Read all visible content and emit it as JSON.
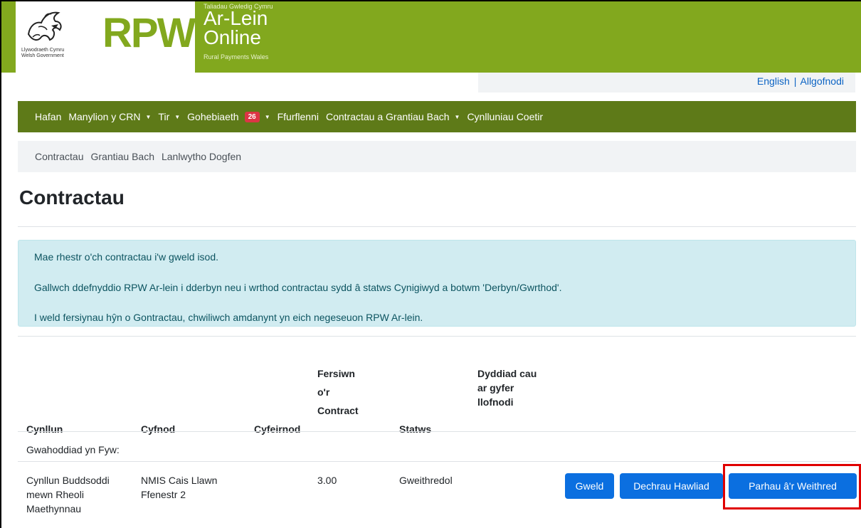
{
  "header": {
    "gov_name_line1": "Llywodraeth Cymru",
    "gov_name_line2": "Welsh Government",
    "rpw_logo": "RPW",
    "tagline_top": "Taliadau Gwledig Cymru",
    "product_line1": "Ar-Lein",
    "product_line2": "Online",
    "tagline_bottom": "Rural Payments Wales"
  },
  "utility": {
    "english_link": "English",
    "separator": "|",
    "logout_link": "Allgofnodi"
  },
  "main_nav": {
    "items": [
      {
        "label": "Hafan"
      },
      {
        "label": "Manylion y CRN"
      },
      {
        "label": "Tir"
      },
      {
        "label": "Gohebiaeth",
        "badge": "26"
      },
      {
        "label": "Ffurflenni"
      },
      {
        "label": "Contractau a Grantiau Bach"
      },
      {
        "label": "Cynlluniau Coetir"
      }
    ]
  },
  "sub_nav": {
    "items": [
      "Contractau",
      "Grantiau Bach",
      "Lanlwytho Dogfen"
    ]
  },
  "page_title": "Contractau",
  "info_box": {
    "line1": "Mae rhestr o'ch contractau i'w gweld isod.",
    "line2": "Gallwch ddefnyddio RPW Ar-lein i dderbyn neu i wrthod contractau sydd â statws Cynigiwyd a botwm 'Derbyn/Gwrthod'.",
    "line3": "I weld fersiynau hŷn o Gontractau, chwiliwch amdanynt yn eich negeseuon RPW Ar-lein."
  },
  "table": {
    "headers": {
      "scheme": "Cynllun",
      "period": "Cyfnod",
      "reference": "Cyfeirnod",
      "version_l1": "Fersiwn",
      "version_l2": "o'r",
      "version_l3": "Contract",
      "status": "Statws",
      "deadline_l1": "Dyddiad cau",
      "deadline_l2": "ar gyfer",
      "deadline_l3": "llofnodi"
    },
    "group_label": "Gwahoddiad yn Fyw:",
    "rows": [
      {
        "scheme_l1": "Cynllun Buddsoddi",
        "scheme_l2": "mewn Rheoli",
        "scheme_l3": "Maethynnau",
        "period_l1": "NMIS Cais Llawn",
        "period_l2": "Ffenestr 2",
        "reference": "",
        "version": "3.00",
        "status": "Gweithredol",
        "deadline": "",
        "actions": {
          "view": "Gweld",
          "start_claim": "Dechrau Hawliad",
          "continue": "Parhau â'r Weithred"
        }
      }
    ]
  },
  "colors": {
    "header_green": "#82a81e",
    "nav_green": "#5e7a18",
    "button_blue": "#0b6fe0",
    "info_bg": "#d1ecf1",
    "badge_red": "#dc3545",
    "highlight_red": "#e00000"
  }
}
